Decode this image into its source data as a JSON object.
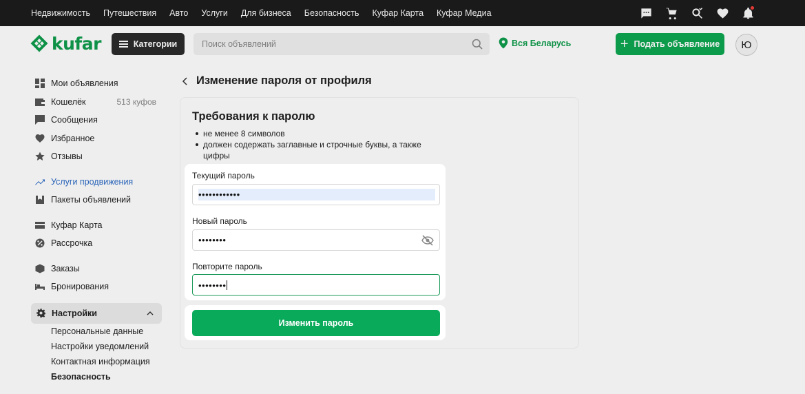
{
  "topnav": [
    "Недвижимость",
    "Путешествия",
    "Авто",
    "Услуги",
    "Для бизнеса",
    "Безопасность",
    "Куфар Карта",
    "Куфар Медиа"
  ],
  "header": {
    "logo_text": "kufar",
    "categories_label": "Категории",
    "search_placeholder": "Поиск объявлений",
    "region": "Вся Беларусь",
    "post_label": "Подать объявление",
    "avatar_letter": "Ю"
  },
  "sidebar": {
    "my_ads": "Мои объявления",
    "wallet": "Кошелёк",
    "wallet_balance": "513 куфов",
    "messages": "Сообщения",
    "favorites": "Избранное",
    "reviews": "Отзывы",
    "promo": "Услуги продвижения",
    "packages": "Пакеты объявлений",
    "card": "Куфар Карта",
    "installments": "Рассрочка",
    "orders": "Заказы",
    "bookings": "Бронирования",
    "settings": "Настройки",
    "sub": [
      "Персональные данные",
      "Настройки уведомлений",
      "Контактная информация",
      "Безопасность"
    ]
  },
  "main": {
    "title": "Изменение пароля от профиля",
    "req_title": "Требования к паролю",
    "requirements": [
      "не менее 8 символов",
      "должен содержать заглавные и строчные буквы, а также цифры"
    ],
    "current_label": "Текущий пароль",
    "current_value": "••••••••••••",
    "new_label": "Новый пароль",
    "new_value": "••••••••",
    "repeat_label": "Повторите пароль",
    "repeat_value": "••••••••",
    "submit_label": "Изменить пароль"
  },
  "colors": {
    "brand_green": "#0ca750",
    "promo_blue": "#2e6cc7",
    "topbar": "#1a1a1a"
  }
}
